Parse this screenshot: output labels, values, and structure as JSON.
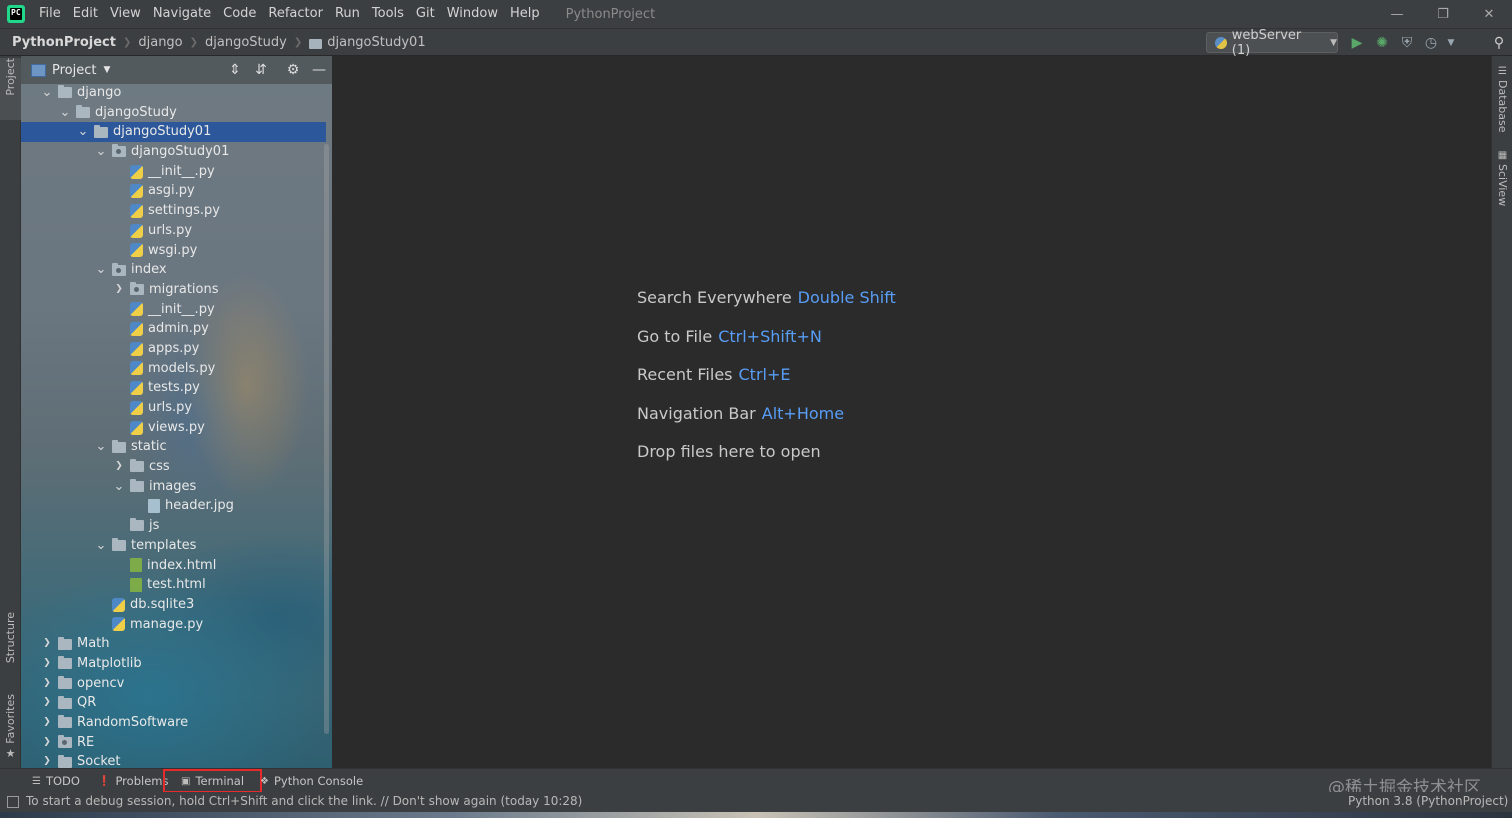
{
  "menubar": {
    "items": [
      "File",
      "Edit",
      "View",
      "Navigate",
      "Code",
      "Refactor",
      "Run",
      "Tools",
      "Git",
      "Window",
      "Help"
    ],
    "window_title": "PythonProject"
  },
  "navbar": {
    "breadcrumb": [
      "PythonProject",
      "django",
      "djangoStudy",
      "djangoStudy01"
    ],
    "run_config": "webServer (1)"
  },
  "left_strip": {
    "project_tab": "Project",
    "structure_tab": "Structure",
    "favorites_tab": "Favorites"
  },
  "right_strip": {
    "database_tab": "Database",
    "sciview_tab": "SciView"
  },
  "project_panel": {
    "title": "Project",
    "tree": [
      {
        "label": "django",
        "type": "folder",
        "depth": 0,
        "expanded": true
      },
      {
        "label": "djangoStudy",
        "type": "folder",
        "depth": 1,
        "expanded": true
      },
      {
        "label": "djangoStudy01",
        "type": "folder",
        "depth": 2,
        "expanded": true,
        "selected": true
      },
      {
        "label": "djangoStudy01",
        "type": "pkg",
        "depth": 3,
        "expanded": true
      },
      {
        "label": "__init__.py",
        "type": "py",
        "depth": 4
      },
      {
        "label": "asgi.py",
        "type": "py",
        "depth": 4
      },
      {
        "label": "settings.py",
        "type": "py",
        "depth": 4
      },
      {
        "label": "urls.py",
        "type": "py",
        "depth": 4
      },
      {
        "label": "wsgi.py",
        "type": "py",
        "depth": 4
      },
      {
        "label": "index",
        "type": "pkg",
        "depth": 3,
        "expanded": true
      },
      {
        "label": "migrations",
        "type": "pkg",
        "depth": 4,
        "expanded": false
      },
      {
        "label": "__init__.py",
        "type": "py",
        "depth": 4
      },
      {
        "label": "admin.py",
        "type": "py",
        "depth": 4
      },
      {
        "label": "apps.py",
        "type": "py",
        "depth": 4
      },
      {
        "label": "models.py",
        "type": "py",
        "depth": 4
      },
      {
        "label": "tests.py",
        "type": "py",
        "depth": 4
      },
      {
        "label": "urls.py",
        "type": "py",
        "depth": 4
      },
      {
        "label": "views.py",
        "type": "py",
        "depth": 4
      },
      {
        "label": "static",
        "type": "folder",
        "depth": 3,
        "expanded": true
      },
      {
        "label": "css",
        "type": "folder",
        "depth": 4,
        "expanded": false
      },
      {
        "label": "images",
        "type": "folder",
        "depth": 4,
        "expanded": true
      },
      {
        "label": "header.jpg",
        "type": "img",
        "depth": 5
      },
      {
        "label": "js",
        "type": "folder",
        "depth": 4
      },
      {
        "label": "templates",
        "type": "folder",
        "depth": 3,
        "expanded": true
      },
      {
        "label": "index.html",
        "type": "html",
        "depth": 4
      },
      {
        "label": "test.html",
        "type": "html",
        "depth": 4
      },
      {
        "label": "db.sqlite3",
        "type": "db",
        "depth": 3
      },
      {
        "label": "manage.py",
        "type": "py",
        "depth": 3
      },
      {
        "label": "Math",
        "type": "folder",
        "depth": 0,
        "expanded": false
      },
      {
        "label": "Matplotlib",
        "type": "folder",
        "depth": 0,
        "expanded": false
      },
      {
        "label": "opencv",
        "type": "folder",
        "depth": 0,
        "expanded": false
      },
      {
        "label": "QR",
        "type": "folder",
        "depth": 0,
        "expanded": false
      },
      {
        "label": "RandomSoftware",
        "type": "folder",
        "depth": 0,
        "expanded": false
      },
      {
        "label": "RE",
        "type": "pkg",
        "depth": 0,
        "expanded": false
      },
      {
        "label": "Socket",
        "type": "folder",
        "depth": 0,
        "expanded": false
      }
    ]
  },
  "editor": {
    "hints": [
      {
        "label": "Search Everywhere",
        "shortcut": "Double Shift"
      },
      {
        "label": "Go to File",
        "shortcut": "Ctrl+Shift+N"
      },
      {
        "label": "Recent Files",
        "shortcut": "Ctrl+E"
      },
      {
        "label": "Navigation Bar",
        "shortcut": "Alt+Home"
      },
      {
        "label": "Drop files here to open",
        "shortcut": ""
      }
    ]
  },
  "bottom_tabs": {
    "todo": "TODO",
    "problems": "Problems",
    "terminal": "Terminal",
    "python_console": "Python Console"
  },
  "watermark": "@稀土掘金技术社区",
  "status": {
    "message": "To start a debug session, hold Ctrl+Shift and click the link. // Don't show again (today 10:28)",
    "interpreter": "Python 3.8 (PythonProject)"
  },
  "colors": {
    "accent_link": "#589df6",
    "selection": "#2152a0",
    "highlight_box": "#e52b2b",
    "run_green": "#59a869"
  },
  "icons": [
    "pycharm-logo-icon",
    "folder-icon",
    "python-file-icon",
    "html-file-icon",
    "image-file-icon",
    "run-icon",
    "debug-icon",
    "coverage-icon",
    "profile-icon",
    "search-icon",
    "gear-icon",
    "collapse-all-icon",
    "expand-all-icon",
    "minimize-icon",
    "terminal-icon",
    "todo-icon",
    "problems-icon",
    "python-console-icon"
  ]
}
